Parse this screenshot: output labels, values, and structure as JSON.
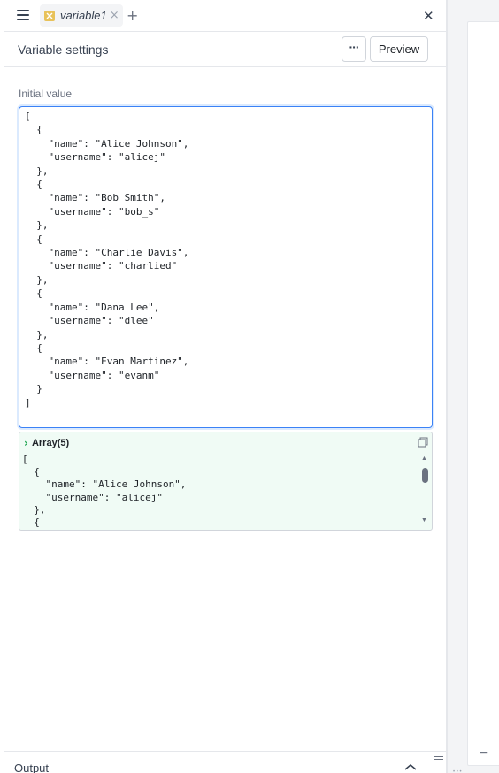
{
  "tab": {
    "label": "variable1"
  },
  "header": {
    "title": "Variable settings",
    "more_label": "···",
    "preview_label": "Preview"
  },
  "editor": {
    "label": "Initial value",
    "value": "[\n  {\n    \"name\": \"Alice Johnson\",\n    \"username\": \"alicej\"\n  },\n  {\n    \"name\": \"Bob Smith\",\n    \"username\": \"bob_s\"\n  },\n  {\n    \"name\": \"Charlie Davis\",\n    \"username\": \"charlied\"\n  },\n  {\n    \"name\": \"Dana Lee\",\n    \"username\": \"dlee\"\n  },\n  {\n    \"name\": \"Evan Martinez\",\n    \"username\": \"evanm\"\n  }\n]"
  },
  "preview": {
    "type_label": "Array(5)",
    "code": "[\n  {\n    \"name\": \"Alice Johnson\",\n    \"username\": \"alicej\"\n  },\n  {"
  },
  "output": {
    "label": "Output"
  },
  "colors": {
    "accent": "#3b82f6",
    "preview_bg": "#f0fbf5",
    "variable_icon": "#e8c25a",
    "chevron": "#16a34a"
  }
}
